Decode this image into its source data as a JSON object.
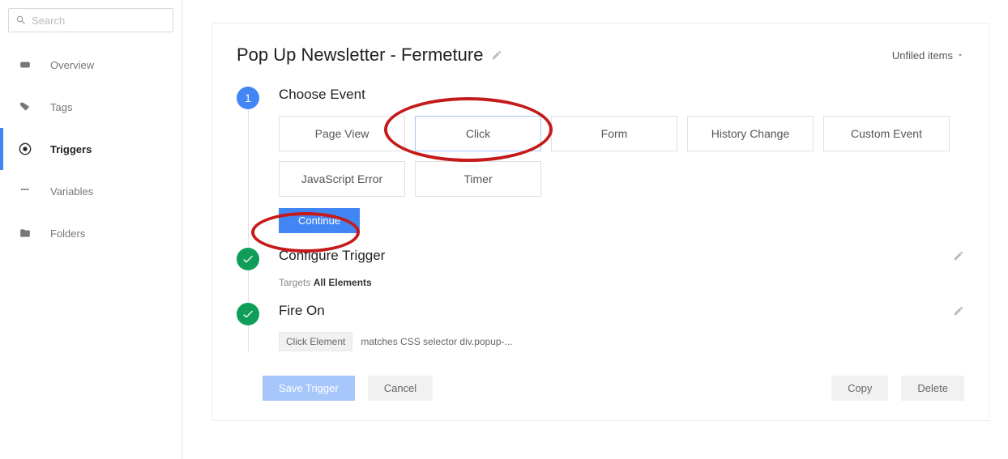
{
  "search": {
    "placeholder": "Search"
  },
  "nav": {
    "overview": "Overview",
    "tags": "Tags",
    "triggers": "Triggers",
    "variables": "Variables",
    "folders": "Folders"
  },
  "page": {
    "title": "Pop Up Newsletter - Fermeture",
    "unfiled": "Unfiled items"
  },
  "step1": {
    "num": "1",
    "title": "Choose Event"
  },
  "events": {
    "pageview": "Page View",
    "click": "Click",
    "form": "Form",
    "history": "History Change",
    "custom": "Custom Event",
    "jserror": "JavaScript Error",
    "timer": "Timer"
  },
  "continue": "Continue",
  "step2": {
    "title": "Configure Trigger",
    "targets_prefix": "Targets ",
    "targets_value": "All Elements"
  },
  "step3": {
    "title": "Fire On",
    "chip": "Click Element",
    "condition": "matches CSS selector div.popup-..."
  },
  "footer": {
    "save": "Save Trigger",
    "cancel": "Cancel",
    "copy": "Copy",
    "delete": "Delete"
  }
}
